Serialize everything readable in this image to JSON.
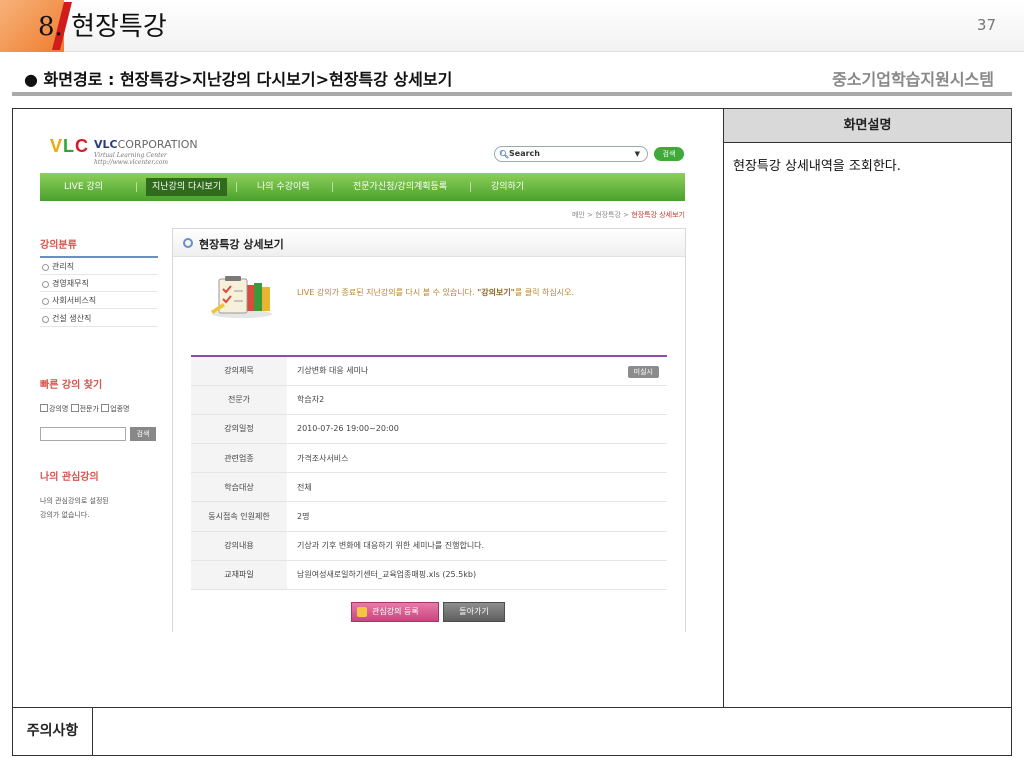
{
  "slide": {
    "title": "8. 현장특강",
    "page_number": "37",
    "path": "● 화면경로 : 현장특강>지난강의 다시보기>현장특강 상세보기",
    "system_name": "중소기업학습지원시스템"
  },
  "description_panel": {
    "header": "화면설명",
    "text": "현장특강 상세내역을 조회한다."
  },
  "notes": {
    "label": "주의사항",
    "text": ""
  },
  "site": {
    "logo": {
      "mark_v": "V",
      "mark_l": "L",
      "mark_c": "C",
      "name_bold": "VLC",
      "name_rest": "CORPORATION",
      "tagline": "Virtual Learning Center",
      "url": "http://www.vlcenter.com"
    },
    "search": {
      "label": "Search",
      "button": "검색"
    },
    "nav": [
      {
        "label": "LIVE 강의"
      },
      {
        "label": "지난강의 다시보기"
      },
      {
        "label": "나의 수강이력"
      },
      {
        "label": "전문가신청/강의계획등록"
      },
      {
        "label": "강의하기"
      }
    ],
    "breadcrumb": {
      "path": "메인 > 현장특강 > ",
      "current": "현장특강 상세보기"
    },
    "sidebar": {
      "category_title": "강의분류",
      "categories": [
        "관리직",
        "경영재무직",
        "사회서비스직",
        "건설 생산직"
      ],
      "quick_title": "빠른 강의 찾기",
      "checkboxes": [
        "강의명",
        "전문가",
        "업종명"
      ],
      "quick_button": "검색",
      "fav_title": "나의 관심강의",
      "fav_empty_line1": "나의 관심강의로 설정된",
      "fav_empty_line2": "강의가 없습니다."
    },
    "content": {
      "title": "현장특강 상세보기",
      "intro_prefix": "LIVE 강의가 종료된 지난강의를 다시 볼 수 있습니다. ",
      "intro_bold": "\"강의보기\"",
      "intro_suffix": "를 클릭 하십시오.",
      "status_tag": "미실시",
      "rows": [
        {
          "label": "강의제목",
          "value": "기상변화 대응 세미나"
        },
        {
          "label": "전문가",
          "value": "학습자2"
        },
        {
          "label": "강의일정",
          "value": "2010-07-26 19:00~20:00"
        },
        {
          "label": "관련업종",
          "value": "가격조사서비스"
        },
        {
          "label": "학습대상",
          "value": "전체"
        },
        {
          "label": "동시접속 인원제한",
          "value": "2명"
        },
        {
          "label": "강의내용",
          "value": "기상과 기후 변화에 대응하기 위한 세미나를 진행합니다."
        },
        {
          "label": "교재파일",
          "value": "남원여성새로일하기센터_교육업종매핑.xls (25.5kb)"
        }
      ],
      "buttons": {
        "favorite": "관심강의 등록",
        "back": "돌아가기"
      }
    }
  },
  "colors": {
    "nav_green": "#4aa02d",
    "table_accent": "#8a4ea6",
    "favorite_button": "#c9467e",
    "sidebar_title": "#d9534f",
    "slide_accent": "#ef7d2f"
  }
}
